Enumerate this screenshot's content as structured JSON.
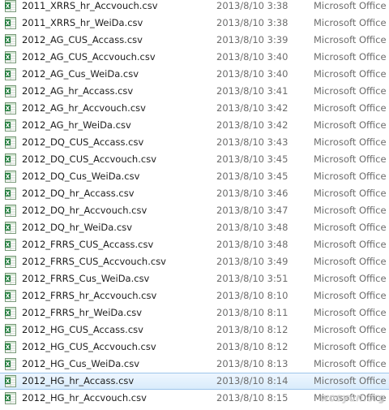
{
  "files": [
    {
      "name": "2011_XRRS_hr_Accvouch.csv",
      "date": "2013/8/10 3:38",
      "type": "Microsoft Office"
    },
    {
      "name": "2011_XRRS_hr_WeiDa.csv",
      "date": "2013/8/10 3:38",
      "type": "Microsoft Office"
    },
    {
      "name": "2012_AG_CUS_Accass.csv",
      "date": "2013/8/10 3:39",
      "type": "Microsoft Office"
    },
    {
      "name": "2012_AG_CUS_Accvouch.csv",
      "date": "2013/8/10 3:40",
      "type": "Microsoft Office"
    },
    {
      "name": "2012_AG_Cus_WeiDa.csv",
      "date": "2013/8/10 3:40",
      "type": "Microsoft Office"
    },
    {
      "name": "2012_AG_hr_Accass.csv",
      "date": "2013/8/10 3:41",
      "type": "Microsoft Office"
    },
    {
      "name": "2012_AG_hr_Accvouch.csv",
      "date": "2013/8/10 3:42",
      "type": "Microsoft Office"
    },
    {
      "name": "2012_AG_hr_WeiDa.csv",
      "date": "2013/8/10 3:42",
      "type": "Microsoft Office"
    },
    {
      "name": "2012_DQ_CUS_Accass.csv",
      "date": "2013/8/10 3:43",
      "type": "Microsoft Office"
    },
    {
      "name": "2012_DQ_CUS_Accvouch.csv",
      "date": "2013/8/10 3:45",
      "type": "Microsoft Office"
    },
    {
      "name": "2012_DQ_Cus_WeiDa.csv",
      "date": "2013/8/10 3:45",
      "type": "Microsoft Office"
    },
    {
      "name": "2012_DQ_hr_Accass.csv",
      "date": "2013/8/10 3:46",
      "type": "Microsoft Office"
    },
    {
      "name": "2012_DQ_hr_Accvouch.csv",
      "date": "2013/8/10 3:47",
      "type": "Microsoft Office"
    },
    {
      "name": "2012_DQ_hr_WeiDa.csv",
      "date": "2013/8/10 3:48",
      "type": "Microsoft Office"
    },
    {
      "name": "2012_FRRS_CUS_Accass.csv",
      "date": "2013/8/10 3:48",
      "type": "Microsoft Office"
    },
    {
      "name": "2012_FRRS_CUS_Accvouch.csv",
      "date": "2013/8/10 3:49",
      "type": "Microsoft Office"
    },
    {
      "name": "2012_FRRS_Cus_WeiDa.csv",
      "date": "2013/8/10 3:51",
      "type": "Microsoft Office"
    },
    {
      "name": "2012_FRRS_hr_Accvouch.csv",
      "date": "2013/8/10 8:10",
      "type": "Microsoft Office"
    },
    {
      "name": "2012_FRRS_hr_WeiDa.csv",
      "date": "2013/8/10 8:11",
      "type": "Microsoft Office"
    },
    {
      "name": "2012_HG_CUS_Accass.csv",
      "date": "2013/8/10 8:12",
      "type": "Microsoft Office"
    },
    {
      "name": "2012_HG_CUS_Accvouch.csv",
      "date": "2013/8/10 8:12",
      "type": "Microsoft Office"
    },
    {
      "name": "2012_HG_Cus_WeiDa.csv",
      "date": "2013/8/10 8:13",
      "type": "Microsoft Office"
    },
    {
      "name": "2012_HG_hr_Accass.csv",
      "date": "2013/8/10 8:14",
      "type": "Microsoft Office",
      "selected": true
    },
    {
      "name": "2012_HG_hr_Accvouch.csv",
      "date": "2013/8/10 8:15",
      "type": "Microsoft Office"
    }
  ],
  "icon": "excel-csv-icon",
  "selection_color": "#d9ecfc",
  "watermark": "wooyun.org"
}
